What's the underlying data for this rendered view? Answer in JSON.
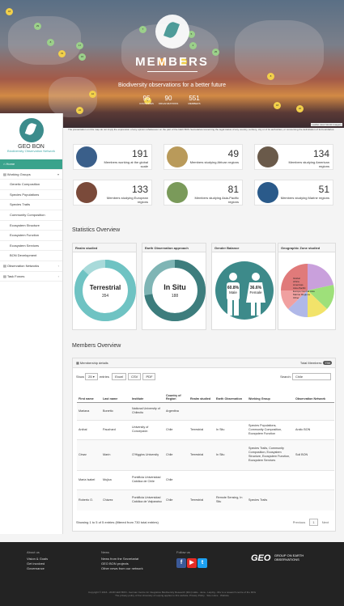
{
  "hero": {
    "title": "MEMBERS",
    "subtitle": "Biodiversity observations for a better future",
    "stats": [
      {
        "value": "95",
        "label": "COUNTRIES"
      },
      {
        "value": "90",
        "label": "ORGANIZATIONS"
      },
      {
        "value": "551",
        "label": "MEMBERS"
      }
    ],
    "map_credit": "Leaflet | Esri World Imagery",
    "caption": "The presentation on this map do not imply the expression of any opinion whatsoever on the part of the GEO BON Secretariat concerning the legal status of any country, territory, city or of its authorities, or concerning the delimitation of its boundaries.",
    "clusters": [
      "18",
      "29",
      "8",
      "76",
      "17",
      "15",
      "10",
      "22",
      "7",
      "5",
      "4",
      "25",
      "4",
      "11",
      "4",
      "8",
      "18",
      "20"
    ]
  },
  "sidebar": {
    "org": "GEO BON",
    "tagline": "Biodiversity Observation Network",
    "items": [
      {
        "label": "Home",
        "type": "home"
      },
      {
        "label": "Working Groups",
        "type": "group"
      },
      {
        "label": "Genetic Composition",
        "type": "sub"
      },
      {
        "label": "Species Populations",
        "type": "sub"
      },
      {
        "label": "Species Traits",
        "type": "sub"
      },
      {
        "label": "Community Composition",
        "type": "sub"
      },
      {
        "label": "Ecosystem Structure",
        "type": "sub"
      },
      {
        "label": "Ecosystem Function",
        "type": "sub"
      },
      {
        "label": "Ecosystem Services",
        "type": "sub"
      },
      {
        "label": "BON Development",
        "type": "sub"
      },
      {
        "label": "Observation Networks",
        "type": "group"
      },
      {
        "label": "Task Forces",
        "type": "group"
      }
    ]
  },
  "stat_cards": [
    {
      "value": "191",
      "label": "Members working at the global scale",
      "color": "#3a5f8a"
    },
    {
      "value": "49",
      "label": "Members studying African regions",
      "color": "#b99a5a"
    },
    {
      "value": "134",
      "label": "Members studying American regions",
      "color": "#6a5a4a"
    },
    {
      "value": "133",
      "label": "Members studying European regions",
      "color": "#7a4a3a"
    },
    {
      "value": "81",
      "label": "Members studying Asia-Pacific regions",
      "color": "#7a9a5a"
    },
    {
      "value": "51",
      "label": "Members studying Marine regions",
      "color": "#2a5a8a"
    }
  ],
  "statistics": {
    "title": "Statistics Overview",
    "panels": [
      {
        "title": "Realm studied",
        "label": "Terrestrial",
        "value": "354",
        "color": "#6fc3c3"
      },
      {
        "title": "Earth Observation approach",
        "label": "In Situ",
        "value": "188",
        "color": "#3d7d7d"
      },
      {
        "title": "Gender Balance",
        "male_pct": "60.8%",
        "male": "Male",
        "female_pct": "36.6%",
        "female": "Female"
      },
      {
        "title": "Geographic Zone studied",
        "legend": [
          "Global",
          "Africa",
          "Americas",
          "Asia-Pacific",
          "Europe Central Asia",
          "Marine Regions",
          "Other"
        ]
      }
    ]
  },
  "members": {
    "title": "Members Overview",
    "panel_title": "Membership details",
    "total_label": "Total Members:",
    "total": "730",
    "show": "Show",
    "entries_value": "25",
    "entries_label": "entries",
    "buttons": [
      "Excel",
      "CSV",
      "PDF"
    ],
    "search_label": "Search:",
    "search_value": "Chile",
    "columns": [
      "First name",
      "Last name",
      "Institute",
      "Country of Region",
      "Realm studied",
      "Earth Observation",
      "Working Group",
      "Observation Network"
    ],
    "rows": [
      [
        "Mariana",
        "Bonetto",
        "National University of Chilecito",
        "Argentina",
        "",
        "",
        "",
        ""
      ],
      [
        "Aníbal",
        "Pauchard",
        "University of Concepción",
        "Chile",
        "Terrestrial",
        "In Situ",
        "Species Populations, Community Composition, Ecosystem Function",
        "Arctic BON"
      ],
      [
        "César",
        "Marín",
        "O'Higgins University",
        "Chile",
        "Terrestrial",
        "In Situ",
        "Species Traits, Community Composition, Ecosystem Structure, Ecosystem Function, Ecosystem Services",
        "Soil BON"
      ],
      [
        "María Isabel",
        "Mujica",
        "Pontificia Universidad Católica de Chile",
        "Chile",
        "",
        "",
        "",
        ""
      ],
      [
        "Roberto O.",
        "Chávez",
        "Pontificia Universidad Católica de Valparaíso",
        "Chile",
        "Terrestrial",
        "Remote Sensing, In Situ",
        "Species Traits",
        ""
      ]
    ],
    "info": "Showing 1 to 5 of 5 entries (filtered from 730 total entries)",
    "prev": "Previous",
    "page": "1",
    "next": "Next"
  },
  "footer": {
    "cols": [
      {
        "title": "About us",
        "links": [
          "Vision & Goals",
          "Get involved",
          "Governance"
        ]
      },
      {
        "title": "News",
        "links": [
          "News from the Secretariat",
          "GEO BON projects",
          "Other news from our network"
        ]
      },
      {
        "title": "Follow us",
        "links": []
      }
    ],
    "geo_logo": "GEO",
    "geo_text": "GROUP ON EARTH OBSERVATIONS",
    "copyright": "Copyright © 2016 - 2018 GEO BON - German Centre for Integrative Biodiversity Research (iDiv) Halle - Jena - Leipzig - iDiv is a research centre of the DFG",
    "privacy": "The privacy policy of the University of Leipzig applies to this website. Privacy Policy · Site notice · Website"
  }
}
